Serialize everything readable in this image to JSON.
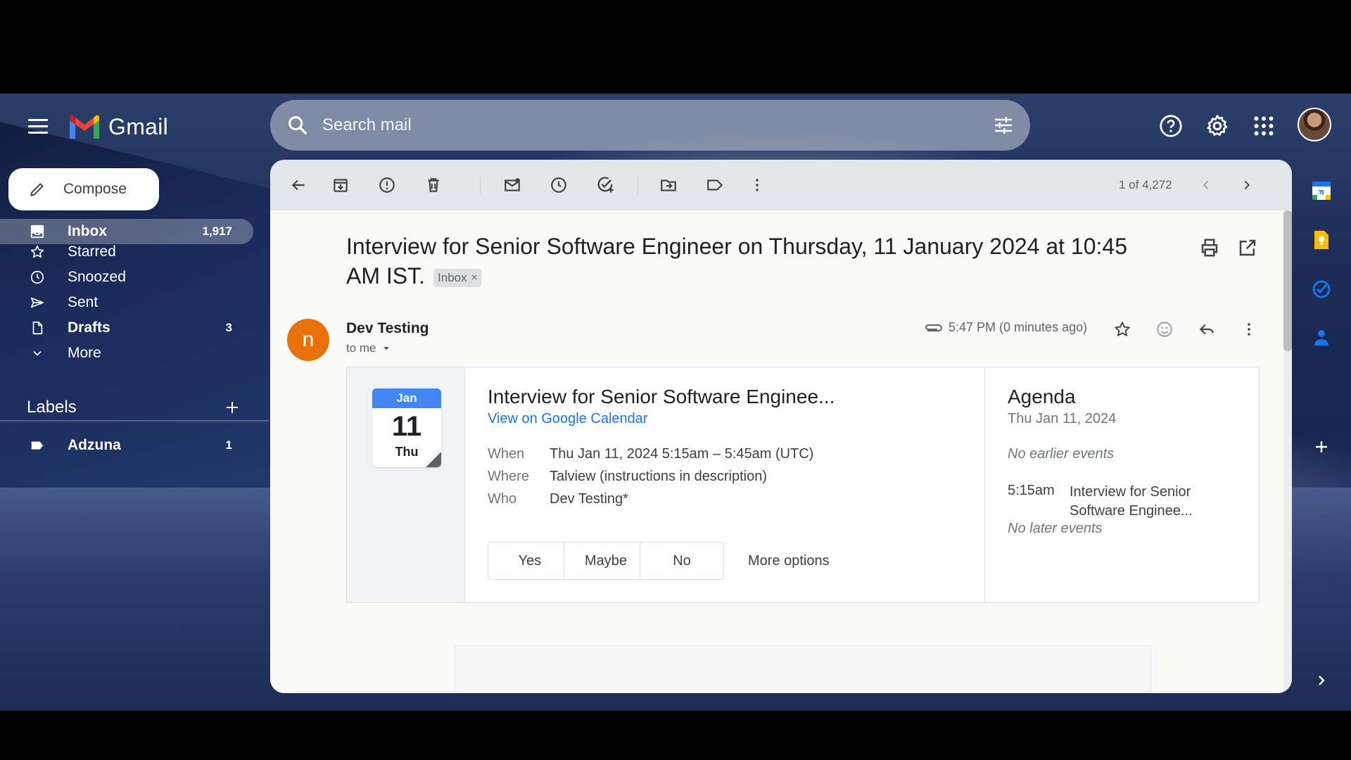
{
  "app": {
    "name": "Gmail"
  },
  "search": {
    "placeholder": "Search mail"
  },
  "compose": {
    "label": "Compose"
  },
  "nav": [
    {
      "label": "Inbox",
      "count": "1,917",
      "icon": "inbox-icon"
    },
    {
      "label": "Starred",
      "count": "",
      "icon": "star-icon"
    },
    {
      "label": "Snoozed",
      "count": "",
      "icon": "clock-icon"
    },
    {
      "label": "Sent",
      "count": "",
      "icon": "send-icon"
    },
    {
      "label": "Drafts",
      "count": "3",
      "icon": "draft-icon"
    },
    {
      "label": "More",
      "count": "",
      "icon": "chevron-down-icon"
    }
  ],
  "labels": {
    "title": "Labels",
    "items": [
      {
        "label": "Adzuna",
        "count": "1"
      }
    ]
  },
  "toolbar": {
    "pager": "1 of 4,272"
  },
  "email": {
    "subject": "Interview for Senior Software Engineer on Thursday, 11 January 2024 at 10:45 AM IST.",
    "chip": "Inbox",
    "sender_initial": "n",
    "sender": "Dev Testing",
    "to": "to me",
    "time": "5:47 PM (0 minutes ago)"
  },
  "event": {
    "month": "Jan",
    "day": "11",
    "weekday": "Thu",
    "title": "Interview for Senior Software Enginee...",
    "link": "View on Google Calendar",
    "when_label": "When",
    "when": "Thu Jan 11, 2024 5:15am – 5:45am (UTC)",
    "where_label": "Where",
    "where": "Talview (instructions in description)",
    "who_label": "Who",
    "who": "Dev Testing*",
    "rsvp": {
      "yes": "Yes",
      "maybe": "Maybe",
      "no": "No",
      "more": "More options"
    }
  },
  "agenda": {
    "title": "Agenda",
    "date": "Thu Jan 11, 2024",
    "no_earlier": "No earlier events",
    "time": "5:15am",
    "event": "Interview for Senior Software Enginee...",
    "no_later": "No later events"
  },
  "colors": {
    "accent": "#1a73e8",
    "avatar": "#e8710a",
    "calendar": "#4285f4"
  }
}
